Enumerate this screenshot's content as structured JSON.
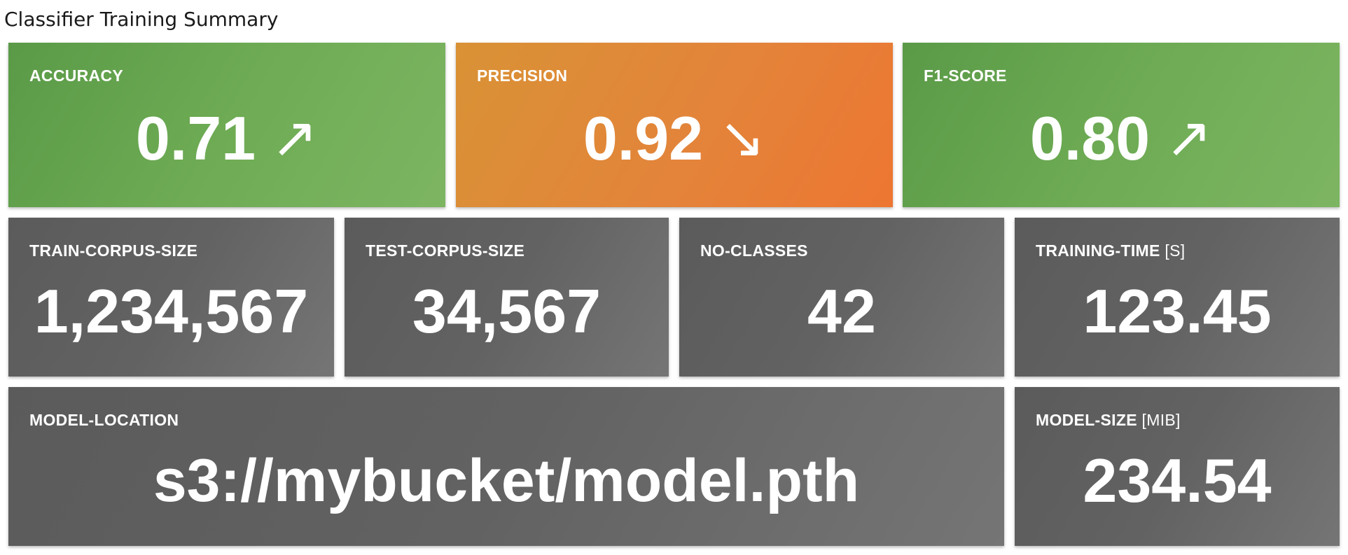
{
  "page": {
    "title": "Classifier Training Summary"
  },
  "metrics": [
    {
      "label": "ACCURACY",
      "value": "0.71",
      "trend": "↗",
      "trend_direction": "up",
      "color": "#6aa851"
    },
    {
      "label": "PRECISION",
      "value": "0.92",
      "trend": "↘",
      "trend_direction": "down",
      "color": "#e5853a"
    },
    {
      "label": "F1-SCORE",
      "value": "0.80",
      "trend": "↗",
      "trend_direction": "up",
      "color": "#6aa851"
    }
  ],
  "stats": [
    {
      "label": "TRAIN-CORPUS-SIZE",
      "unit": "",
      "value": "1,234,567"
    },
    {
      "label": "TEST-CORPUS-SIZE",
      "unit": "",
      "value": "34,567"
    },
    {
      "label": "NO-CLASSES",
      "unit": "",
      "value": "42"
    },
    {
      "label": "TRAINING-TIME",
      "unit": "[S]",
      "value": "123.45"
    }
  ],
  "model": {
    "location_label": "MODEL-LOCATION",
    "location_value": "s3://mybucket/model.pth",
    "size_label": "MODEL-SIZE",
    "size_unit": "[MIB]",
    "size_value": "234.54"
  },
  "colors": {
    "good": "#6aa851",
    "warning": "#e5853a",
    "neutral": "#656565"
  }
}
